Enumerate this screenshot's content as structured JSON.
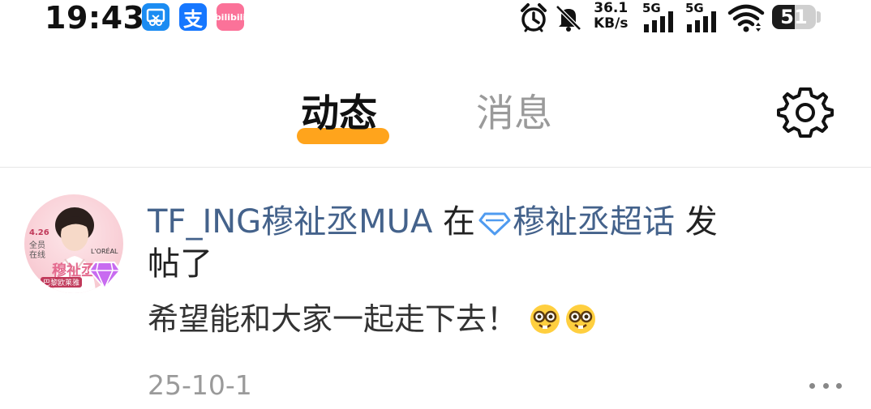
{
  "status_bar": {
    "time": "19:43",
    "apps": [
      {
        "name": "qq-browser-icon",
        "glyph": "✂"
      },
      {
        "name": "alipay-icon",
        "glyph": "支"
      },
      {
        "name": "bilibili-icon",
        "glyph": "bilibili"
      }
    ],
    "net_speed_value": "36.1",
    "net_speed_unit": "KB/s",
    "signal_1": "5G",
    "signal_2": "5G",
    "battery_level": "51",
    "battery_fraction": 0.51
  },
  "header": {
    "tabs": [
      {
        "label": "动态",
        "active": true
      },
      {
        "label": "消息",
        "active": false
      }
    ],
    "accent_color": "#ffa41c"
  },
  "post": {
    "username": "TF_ING穆祉丞MUA",
    "in_word": "在",
    "topic": "穆祉丞超话",
    "action_part1": "发",
    "action_part2": "帖了",
    "avatar_text": {
      "date": "4.26",
      "line1": "全员",
      "line2": "在线",
      "brand": "L'ORÉAL",
      "name": "穆祉丞",
      "caption": "巴黎欧莱雅"
    },
    "body": "希望能和大家一起走下去！",
    "emojis": [
      "nerd-face",
      "nerd-face"
    ],
    "date": "25-10-1",
    "link_color": "#44628b"
  }
}
